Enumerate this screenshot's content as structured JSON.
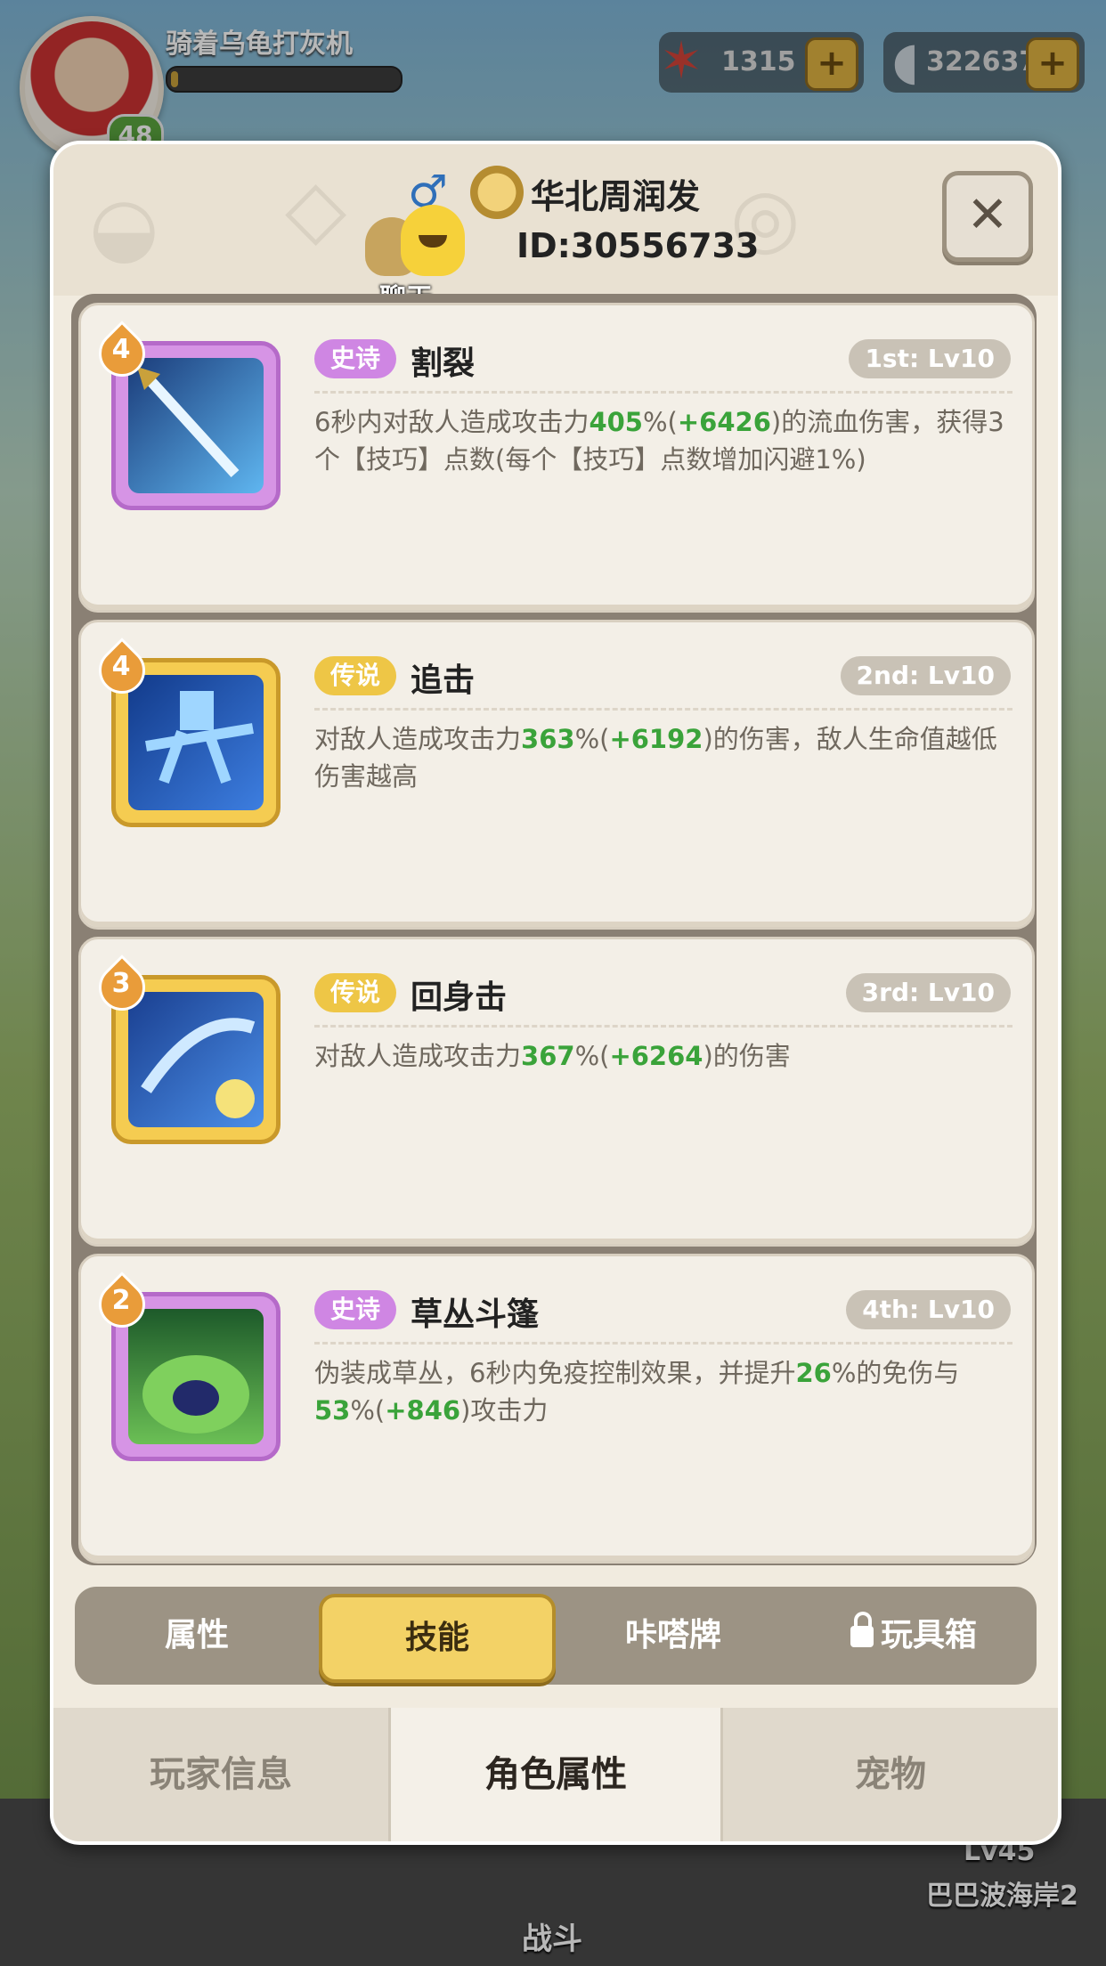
{
  "hud": {
    "player_name": "骑着乌龟打灰机",
    "level": "48",
    "xp_progress": 0.03,
    "currencies": [
      {
        "icon": "starfish-icon",
        "value": "1315"
      },
      {
        "icon": "shell-icon",
        "value": "322637"
      }
    ]
  },
  "background_nav": {
    "battle_label": "战斗",
    "stage_level": "Lv45",
    "stage_name": "巴巴波海岸2"
  },
  "modal": {
    "profile_name": "华北周润发",
    "profile_id": "ID:30556733",
    "chat_label": "聊天",
    "close_icon": "close-icon",
    "skills": [
      {
        "level": "4",
        "rarity": "史诗",
        "rarity_type": "epic",
        "name": "割裂",
        "slot": "1st: Lv10",
        "desc_parts": [
          "6秒内对敌人造成攻击力",
          "405",
          "%(",
          "+6426",
          ")的流血伤害，获得3个【技巧】点数(每个【技巧】点数增加闪避1%)"
        ]
      },
      {
        "level": "4",
        "rarity": "传说",
        "rarity_type": "legend",
        "name": "追击",
        "slot": "2nd: Lv10",
        "desc_parts": [
          "对敌人造成攻击力",
          "363",
          "%(",
          "+6192",
          ")的伤害，敌人生命值越低伤害越高"
        ]
      },
      {
        "level": "3",
        "rarity": "传说",
        "rarity_type": "legend",
        "name": "回身击",
        "slot": "3rd: Lv10",
        "desc_parts": [
          "对敌人造成攻击力",
          "367",
          "%(",
          "+6264",
          ")的伤害"
        ]
      },
      {
        "level": "2",
        "rarity": "史诗",
        "rarity_type": "epic",
        "name": "草丛斗篷",
        "slot": "4th: Lv10",
        "desc_parts": [
          "伪装成草丛，6秒内免疫控制效果，并提升",
          "26",
          "%的免伤与",
          "53",
          "%(",
          "+846",
          ")攻击力"
        ]
      }
    ],
    "sub_tabs": [
      "属性",
      "技能",
      "咔嗒牌",
      "玩具箱"
    ],
    "active_sub_tab": "技能",
    "bottom_tabs": [
      "玩家信息",
      "角色属性",
      "宠物"
    ],
    "active_bottom_tab": "角色属性"
  }
}
